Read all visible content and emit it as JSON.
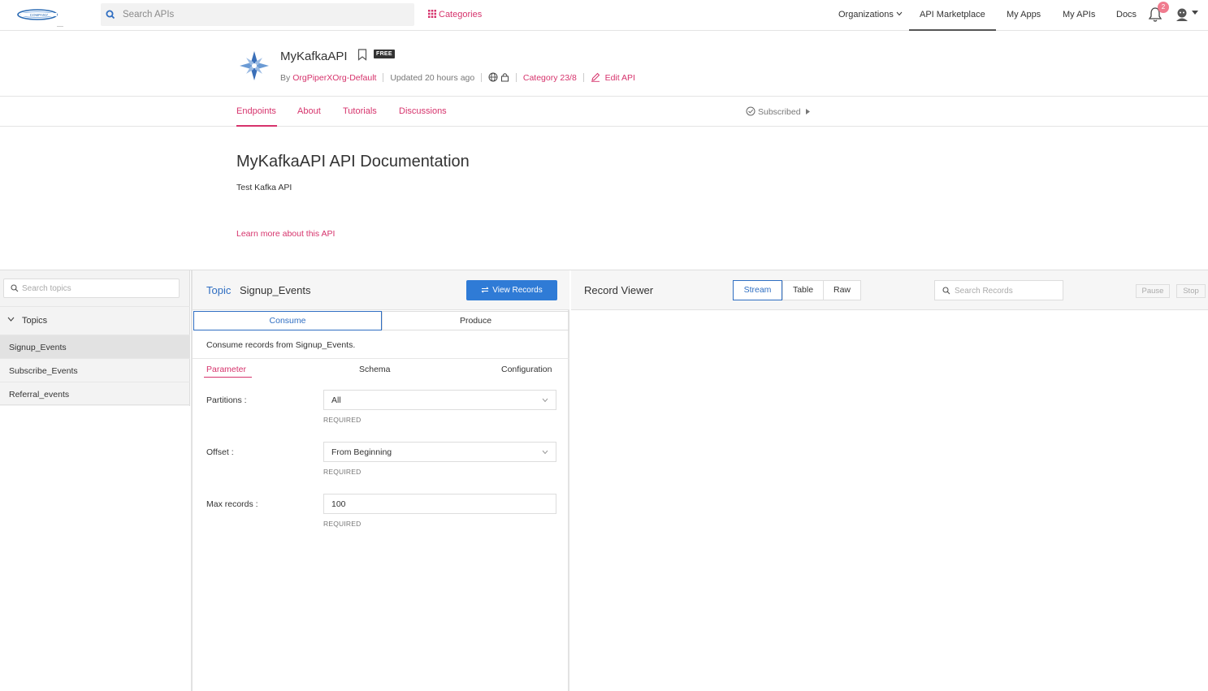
{
  "topnav": {
    "search_placeholder": "Search APIs",
    "categories": "Categories",
    "items": [
      "Organizations",
      "API Marketplace",
      "My Apps",
      "My APIs",
      "Docs"
    ],
    "notification_count": "2"
  },
  "api": {
    "name": "MyKafkaAPI",
    "badge": "FREE",
    "by": "By",
    "org": "OrgPiperXOrg-Default",
    "updated": "Updated 20 hours ago",
    "category": "Category 23/8",
    "edit": "Edit API"
  },
  "tabs": [
    "Endpoints",
    "About",
    "Tutorials",
    "Discussions"
  ],
  "subscribed": "Subscribed",
  "doc": {
    "title": "MyKafkaAPI API Documentation",
    "description": "Test Kafka API",
    "learn_more": "Learn more about this API"
  },
  "sidebar": {
    "search_placeholder": "Search topics",
    "topics_label": "Topics",
    "topics": [
      "Signup_Events",
      "Subscribe_Events",
      "Referral_events"
    ],
    "selected": "Signup_Events"
  },
  "topic_panel": {
    "topic_label": "Topic",
    "topic_value": "Signup_Events",
    "view_records": "View Records",
    "consume": "Consume",
    "produce": "Produce",
    "consume_desc": "Consume records from Signup_Events.",
    "subtabs": [
      "Parameter",
      "Schema",
      "Configuration"
    ],
    "fields": [
      {
        "label": "Partitions :",
        "value": "All",
        "required": "REQUIRED"
      },
      {
        "label": "Offset :",
        "value": "From Beginning",
        "required": "REQUIRED"
      },
      {
        "label": "Max records :",
        "value": "100",
        "required": "REQUIRED"
      }
    ]
  },
  "record_viewer": {
    "title": "Record Viewer",
    "views": [
      "Stream",
      "Table",
      "Raw"
    ],
    "search_placeholder": "Search Records",
    "pause": "Pause",
    "stop": "Stop"
  },
  "colors": {
    "accent_pink": "#d6336c",
    "accent_blue": "#2f6ec2",
    "button_blue": "#2f7bd6"
  }
}
